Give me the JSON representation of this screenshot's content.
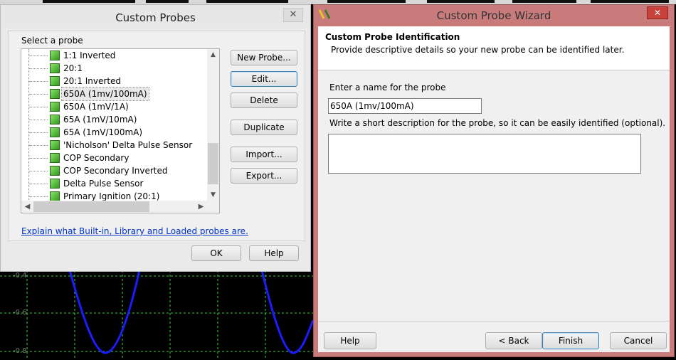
{
  "custom_probes_dialog": {
    "title": "Custom Probes",
    "close_label": "✕",
    "select_label": "Select a probe",
    "probes": [
      "1:1 Inverted",
      "20:1",
      "20:1 Inverted",
      "650A (1mv/100mA)",
      "650A (1mV/1A)",
      "65A (1mV/10mA)",
      "65A (1mV/100mA)",
      "'Nicholson' Delta Pulse Sensor",
      "COP Secondary",
      "COP Secondary Inverted",
      "Delta Pulse Sensor",
      "Primary Ignition (20:1)"
    ],
    "selected_index": 3,
    "buttons": {
      "new_probe": "New Probe...",
      "edit": "Edit...",
      "delete": "Delete",
      "duplicate": "Duplicate",
      "import": "Import...",
      "export": "Export..."
    },
    "help_link": "Explain what Built-in, Library and Loaded probes are.",
    "ok_label": "OK",
    "help_label": "Help"
  },
  "wizard": {
    "title": "Custom Probe Wizard",
    "close_label": "✕",
    "heading": "Custom Probe Identification",
    "subheading": "Provide descriptive details so your new probe can be identified later.",
    "name_prompt": "Enter a name for the probe",
    "name_value": "650A (1mv/100mA)",
    "description_prompt": "Write a short description for the probe, so it can be easily identified (optional).",
    "description_value": "",
    "help_label": "Help",
    "back_label": "< Back",
    "finish_label": "Finish",
    "cancel_label": "Cancel"
  },
  "scope": {
    "y_labels": [
      "-0.4",
      "-0.6",
      "-0.8"
    ],
    "grid_color": "#3ccf3c",
    "trace_color": "#1c1cff"
  }
}
